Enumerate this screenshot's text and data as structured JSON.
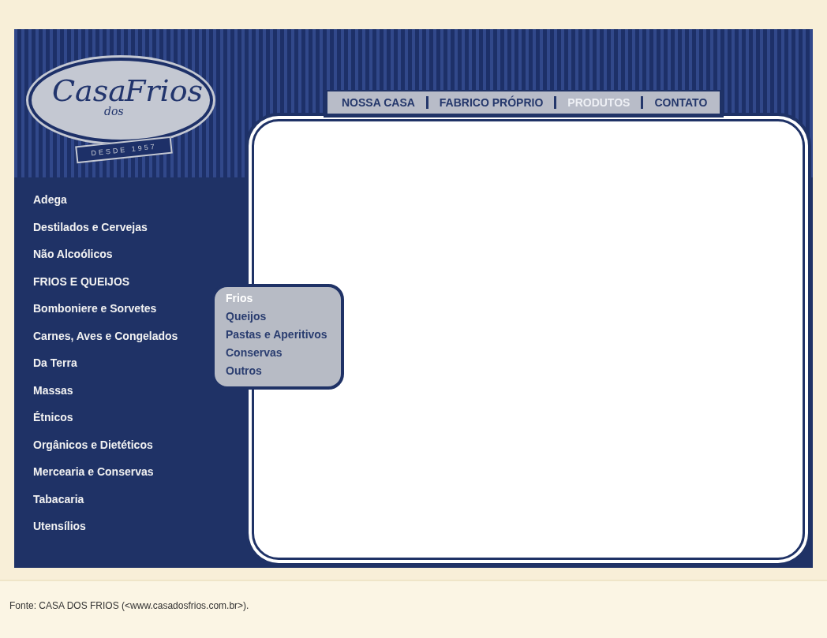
{
  "logo": {
    "words": [
      "Casa",
      "dos",
      "Frios"
    ],
    "tagline": "DESDE 1957"
  },
  "nav": [
    {
      "label": "NOSSA CASA",
      "selected": false
    },
    {
      "label": "FABRICO PRÓPRIO",
      "selected": false
    },
    {
      "label": "PRODUTOS",
      "selected": true
    },
    {
      "label": "CONTATO",
      "selected": false
    }
  ],
  "sidebar": {
    "items": [
      {
        "label": "Adega"
      },
      {
        "label": "Destilados e Cervejas"
      },
      {
        "label": "Não Alcoólicos"
      },
      {
        "label": "FRIOS E QUEIJOS"
      },
      {
        "label": "Bomboniere e Sorvetes"
      },
      {
        "label": "Carnes, Aves e Congelados"
      },
      {
        "label": "Da Terra"
      },
      {
        "label": "Massas"
      },
      {
        "label": "Étnicos"
      },
      {
        "label": "Orgânicos e Dietéticos"
      },
      {
        "label": "Mercearia e Conservas"
      },
      {
        "label": "Tabacaria"
      },
      {
        "label": "Utensílios"
      }
    ]
  },
  "submenu": {
    "items": [
      {
        "label": "Frios",
        "selected": true
      },
      {
        "label": "Queijos",
        "selected": false
      },
      {
        "label": "Pastas e Aperitivos",
        "selected": false
      },
      {
        "label": "Conservas",
        "selected": false
      },
      {
        "label": "Outros",
        "selected": false
      }
    ]
  },
  "caption": "Fonte: CASA DOS FRIOS (<www.casadosfrios.com.br>)."
}
